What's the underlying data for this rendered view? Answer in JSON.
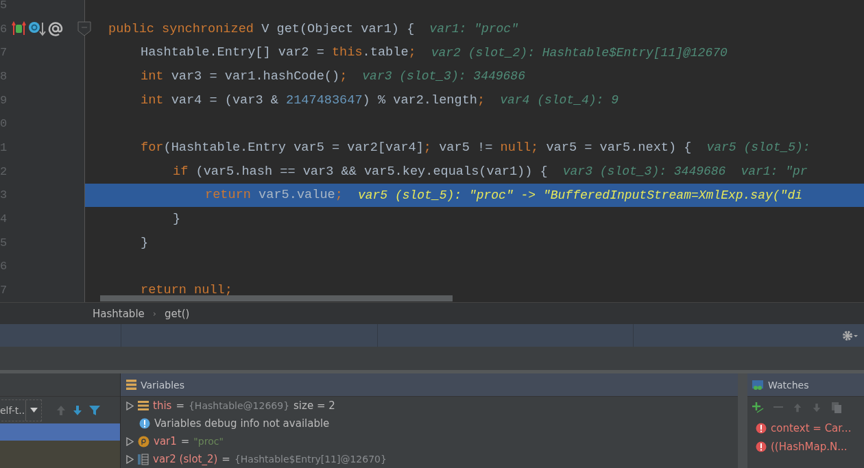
{
  "editor": {
    "lines": [
      {
        "number": "5"
      },
      {
        "number": "6",
        "gutter_icons": true,
        "fold": true,
        "tokens": [
          {
            "kind": "keyword",
            "text": "public synchronized"
          },
          {
            "kind": "plain",
            "text": " V get(Object var1) {"
          },
          {
            "kind": "hint",
            "text": "var1: \"proc\""
          }
        ],
        "children": [
          {
            "number": "7",
            "tokens": [
              {
                "kind": "plain",
                "text": "Hashtable.Entry[] var2 = "
              },
              {
                "kind": "keyword",
                "text": "this"
              },
              {
                "kind": "plain",
                "text": ".table"
              },
              {
                "kind": "keyword",
                "text": ";"
              },
              {
                "kind": "hint",
                "text": "var2 (slot_2): Hashtable$Entry[11]@12670"
              }
            ]
          },
          {
            "number": "8",
            "tokens": [
              {
                "kind": "keyword",
                "text": "int"
              },
              {
                "kind": "plain",
                "text": " var3 = var1.hashCode()"
              },
              {
                "kind": "keyword",
                "text": ";"
              },
              {
                "kind": "hint",
                "text": "var3 (slot_3): 3449686"
              }
            ]
          },
          {
            "number": "9",
            "tokens": [
              {
                "kind": "keyword",
                "text": "int"
              },
              {
                "kind": "plain",
                "text": " var4 = (var3 & "
              },
              {
                "kind": "number",
                "text": "2147483647"
              },
              {
                "kind": "plain",
                "text": ") % var2.length"
              },
              {
                "kind": "keyword",
                "text": ";"
              },
              {
                "kind": "hint",
                "text": "var4 (slot_4): 9"
              }
            ]
          },
          {
            "number": "0"
          },
          {
            "number": "1",
            "tokens": [
              {
                "kind": "keyword",
                "text": "for"
              },
              {
                "kind": "plain",
                "text": "(Hashtable.Entry var5 = var2[var4]"
              },
              {
                "kind": "keyword",
                "text": ";"
              },
              {
                "kind": "plain",
                "text": " var5 != "
              },
              {
                "kind": "keyword",
                "text": "null;"
              },
              {
                "kind": "plain",
                "text": " var5 = var5.next) {"
              },
              {
                "kind": "hint",
                "text": "var5 (slot_5):"
              }
            ],
            "children": [
              {
                "number": "2",
                "tokens": [
                  {
                    "kind": "keyword",
                    "text": "if"
                  },
                  {
                    "kind": "plain",
                    "text": " (var5.hash == var3 && var5.key.equals(var1)) {"
                  },
                  {
                    "kind": "hint",
                    "text": "var3 (slot_3): 3449686"
                  },
                  {
                    "kind": "hint",
                    "text": "var1: \"pr"
                  }
                ],
                "children": [
                  {
                    "number": "3",
                    "selected": true,
                    "tokens": [
                      {
                        "kind": "keyword",
                        "text": "return"
                      },
                      {
                        "kind": "plain",
                        "text": " var5.value"
                      },
                      {
                        "kind": "keyword",
                        "text": ";"
                      },
                      {
                        "kind": "hint",
                        "text": "var5 (slot_5): \"proc\" -> \"BufferedInputStream=XmlExp.say(\"di"
                      }
                    ]
                  }
                ]
              },
              {
                "number": "4",
                "tokens": [
                  {
                    "kind": "plain",
                    "text": "}"
                  }
                ]
              }
            ]
          },
          {
            "number": "5",
            "tokens": [
              {
                "kind": "plain",
                "text": "}"
              }
            ]
          },
          {
            "number": "6"
          },
          {
            "number": "7",
            "tokens": [
              {
                "kind": "keyword",
                "text": "return null;"
              }
            ]
          }
        ]
      }
    ]
  },
  "breadcrumbs": {
    "separator": "›",
    "items": [
      "Hashtable",
      "get()"
    ]
  },
  "frames": {
    "thread_combo": "elf-t..",
    "items": [
      {
        "selected": true
      },
      {
        "selected": false
      }
    ]
  },
  "variables": {
    "title": "Variables",
    "items": [
      {
        "kind": "object",
        "name": "this",
        "operator": "=",
        "value": "{Hashtable@12669}",
        "extra": "size = 2"
      },
      {
        "kind": "info",
        "name": "Variables debug info not available"
      },
      {
        "kind": "param",
        "name": "var1",
        "operator": "=",
        "value": "\"proc\""
      },
      {
        "kind": "array",
        "name": "var2 (slot_2)",
        "operator": "=",
        "value": "{Hashtable$Entry[11]@12670}"
      }
    ]
  },
  "watches": {
    "title": "Watches",
    "items": [
      {
        "text": "context = Car..."
      },
      {
        "text": "((HashMap.N..."
      }
    ]
  }
}
